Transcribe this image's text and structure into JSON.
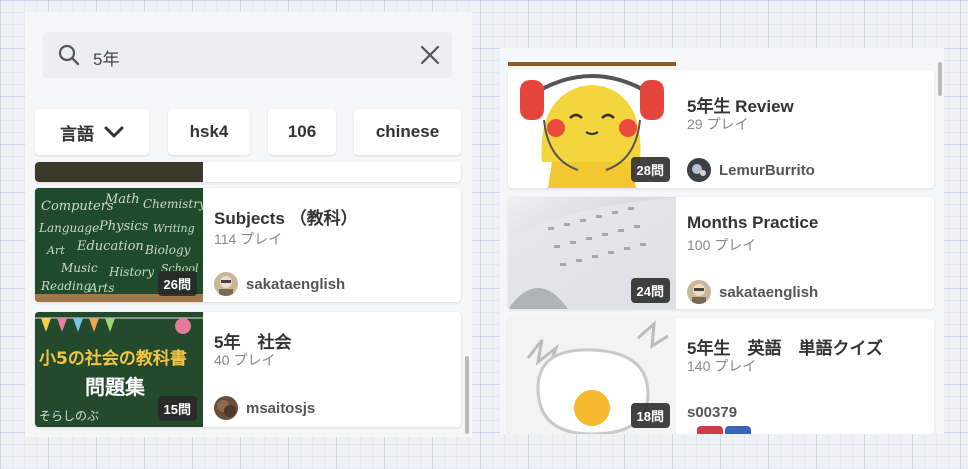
{
  "search": {
    "query": "5年"
  },
  "filters": [
    {
      "label": "言語",
      "has_dropdown": true
    },
    {
      "label": "hsk4"
    },
    {
      "label": "106"
    },
    {
      "label": "chinese"
    }
  ],
  "left_results": [
    {
      "title": "Subjects （教科）",
      "plays": "114 プレイ",
      "author": "sakataenglish",
      "count": "26問"
    },
    {
      "title": "5年　社会",
      "plays": "40 プレイ",
      "author": "msaitosjs",
      "count": "15問"
    }
  ],
  "right_results": [
    {
      "title": "5年生 Review",
      "plays": "29 プレイ",
      "author": "LemurBurrito",
      "count": "28問"
    },
    {
      "title": "Months Practice",
      "plays": "100 プレイ",
      "author": "sakataenglish",
      "count": "24問"
    },
    {
      "title": "5年生　英語　単語クイズ",
      "plays": "140 プレイ",
      "author": "s00379",
      "count": "18問"
    }
  ],
  "colors": {
    "accent_bar": "#8a5a2b",
    "badge_bg": "#2d2d2d",
    "panel_bg": "#f6f7f9"
  }
}
